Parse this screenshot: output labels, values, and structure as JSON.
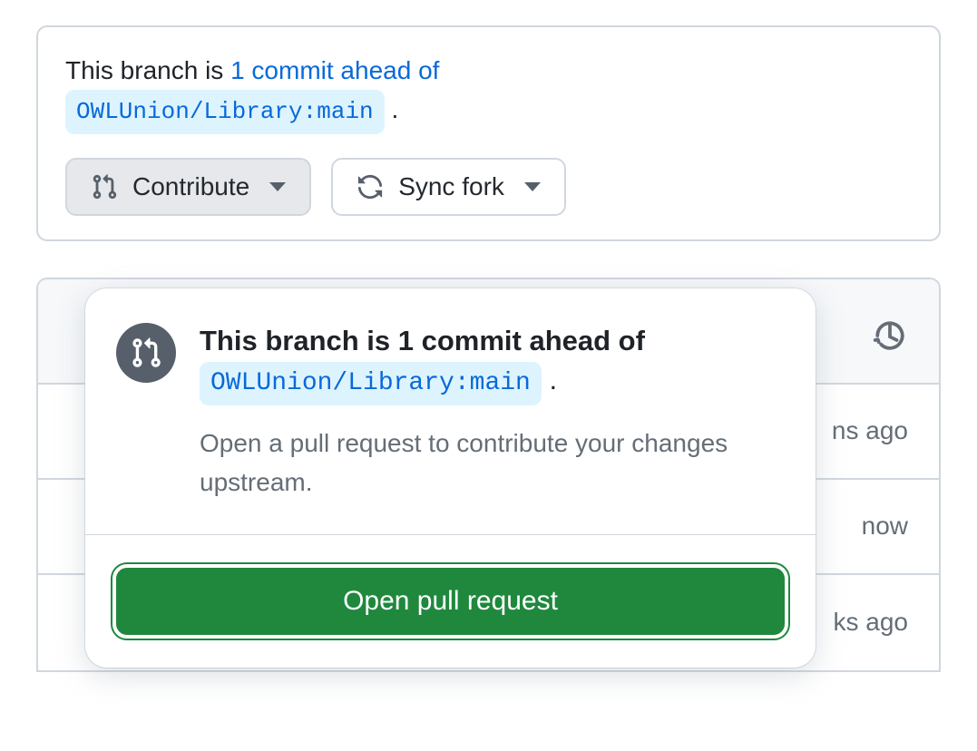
{
  "branchStatus": {
    "prefix": "This branch is",
    "linkText": "1 commit ahead of",
    "repoRef": "OWLUnion/Library:main",
    "period": "."
  },
  "buttons": {
    "contribute": "Contribute",
    "syncFork": "Sync fork"
  },
  "popover": {
    "title": "This branch is 1 commit ahead of",
    "repoRef": "OWLUnion/Library:main",
    "period": ".",
    "description": "Open a pull request to contribute your changes upstream.",
    "primaryAction": "Open pull request"
  },
  "bgRows": {
    "row1": "ns ago",
    "row2": "now",
    "row3": "ks ago"
  }
}
